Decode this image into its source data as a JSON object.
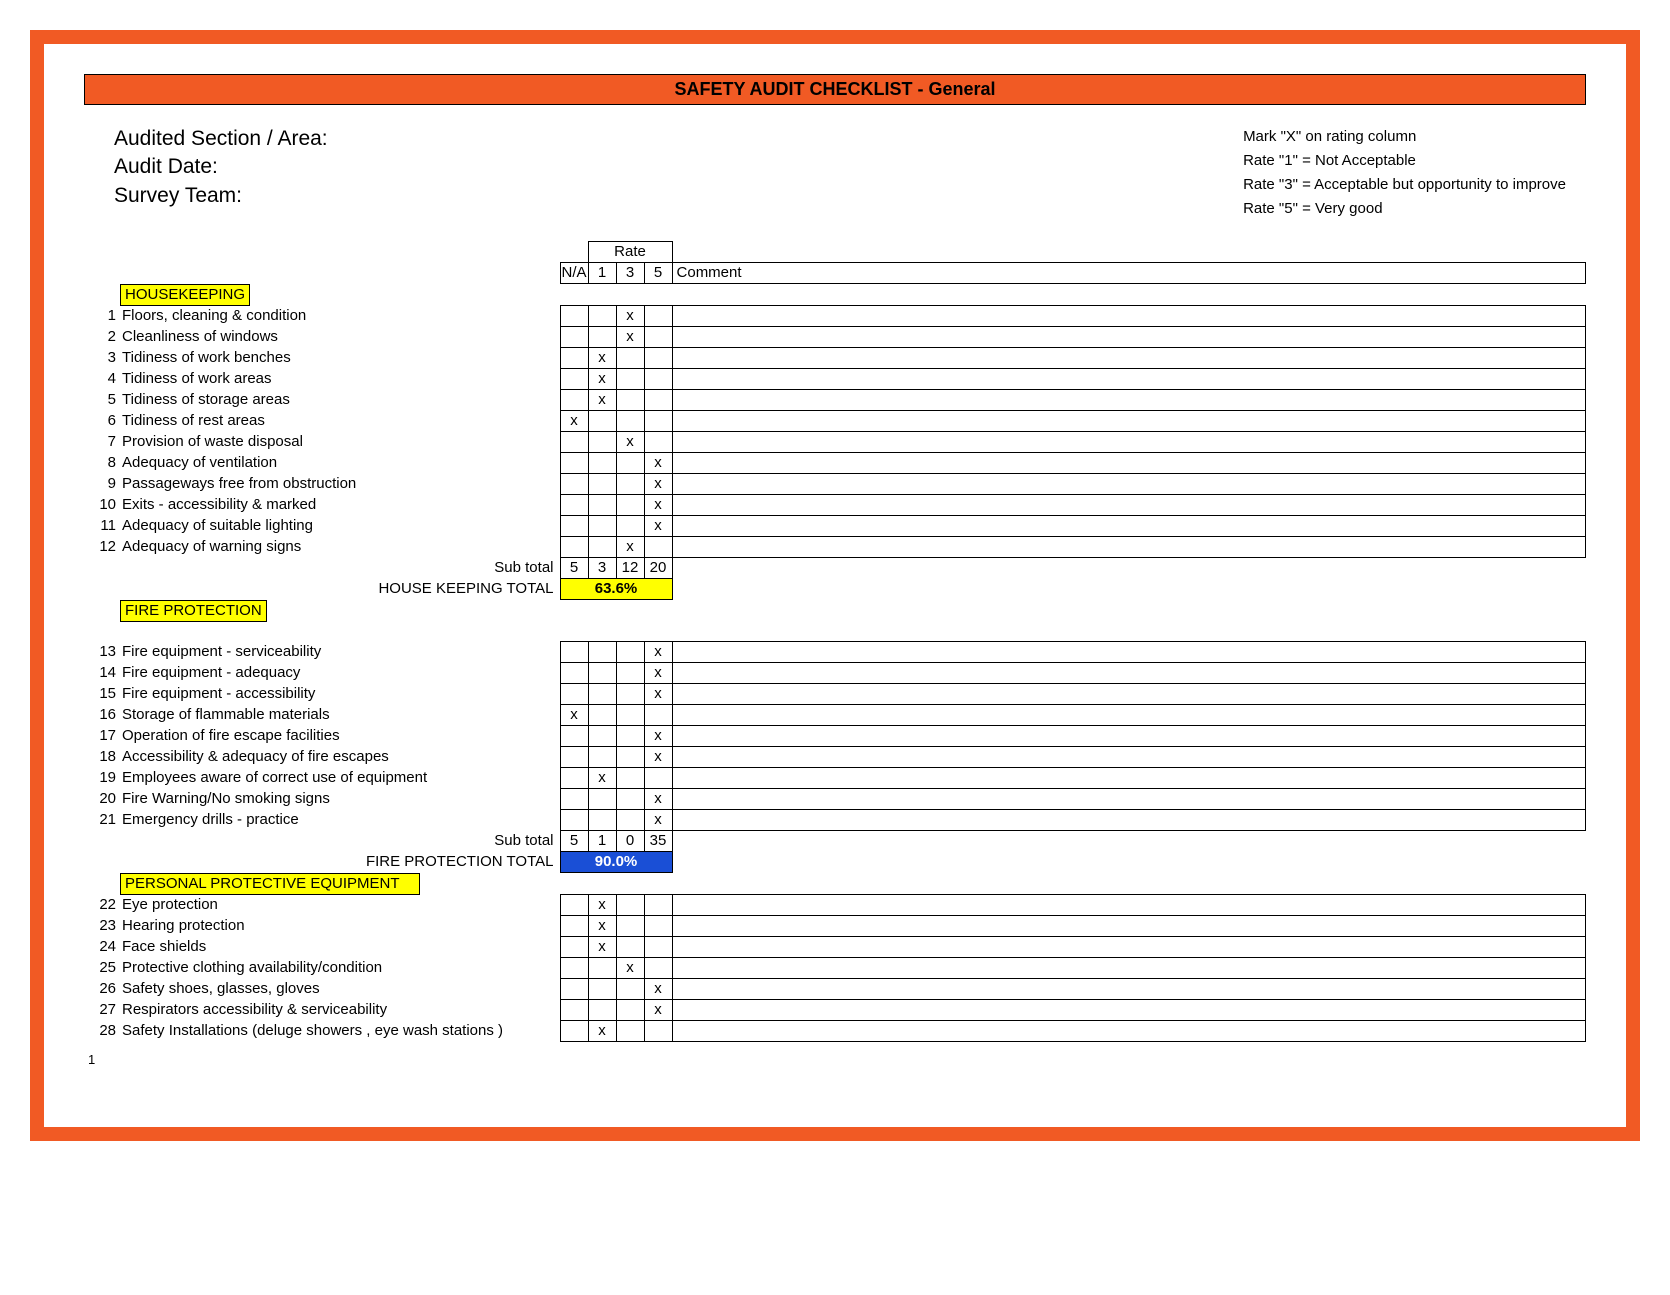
{
  "title": "SAFETY AUDIT CHECKLIST - General",
  "header": {
    "section": "Audited Section / Area:",
    "date": "Audit Date:",
    "team": "Survey Team:",
    "instr1": "Mark \"X\" on rating column",
    "instr2": "Rate \"1\" = Not Acceptable",
    "instr3": "Rate \"3\" = Acceptable but opportunity to improve",
    "instr4": "Rate \"5\" = Very good"
  },
  "cols": {
    "rate": "Rate",
    "na": "N/A",
    "c1": "1",
    "c3": "3",
    "c5": "5",
    "comment": "Comment"
  },
  "labels": {
    "subtotal": "Sub total"
  },
  "sections": {
    "hk": {
      "name": "HOUSEKEEPING",
      "items": [
        {
          "n": "1",
          "t": "Floors, cleaning & condition",
          "m": [
            " ",
            " ",
            "x",
            " "
          ]
        },
        {
          "n": "2",
          "t": "Cleanliness of windows",
          "m": [
            " ",
            " ",
            "x",
            " "
          ]
        },
        {
          "n": "3",
          "t": "Tidiness of work benches",
          "m": [
            " ",
            "x",
            " ",
            " "
          ]
        },
        {
          "n": "4",
          "t": "Tidiness of work areas",
          "m": [
            " ",
            "x",
            " ",
            " "
          ]
        },
        {
          "n": "5",
          "t": "Tidiness of storage areas",
          "m": [
            " ",
            "x",
            " ",
            " "
          ]
        },
        {
          "n": "6",
          "t": "Tidiness of rest areas",
          "m": [
            "x",
            " ",
            " ",
            " "
          ]
        },
        {
          "n": "7",
          "t": "Provision of waste disposal",
          "m": [
            " ",
            " ",
            "x",
            " "
          ]
        },
        {
          "n": "8",
          "t": "Adequacy of ventilation",
          "m": [
            " ",
            " ",
            " ",
            "x"
          ]
        },
        {
          "n": "9",
          "t": "Passageways free from obstruction",
          "m": [
            " ",
            " ",
            " ",
            "x"
          ]
        },
        {
          "n": "10",
          "t": "Exits - accessibility & marked",
          "m": [
            " ",
            " ",
            " ",
            "x"
          ]
        },
        {
          "n": "11",
          "t": "Adequacy of suitable lighting",
          "m": [
            " ",
            " ",
            " ",
            "x"
          ]
        },
        {
          "n": "12",
          "t": "Adequacy of warning signs",
          "m": [
            " ",
            " ",
            "x",
            " "
          ]
        }
      ],
      "sub": [
        "5",
        "3",
        "12",
        "20"
      ],
      "total_label": "HOUSE KEEPING TOTAL",
      "total": "63.6%"
    },
    "fp": {
      "name": "FIRE PROTECTION",
      "items": [
        {
          "n": "13",
          "t": "Fire equipment - serviceability",
          "m": [
            " ",
            " ",
            " ",
            "x"
          ]
        },
        {
          "n": "14",
          "t": "Fire equipment - adequacy",
          "m": [
            " ",
            " ",
            " ",
            "x"
          ]
        },
        {
          "n": "15",
          "t": "Fire equipment - accessibility",
          "m": [
            " ",
            " ",
            " ",
            "x"
          ]
        },
        {
          "n": "16",
          "t": "Storage of flammable materials",
          "m": [
            "x",
            " ",
            " ",
            " "
          ]
        },
        {
          "n": "17",
          "t": "Operation of fire escape facilities",
          "m": [
            " ",
            " ",
            " ",
            "x"
          ]
        },
        {
          "n": "18",
          "t": "Accessibility & adequacy of fire escapes",
          "m": [
            " ",
            " ",
            " ",
            "x"
          ]
        },
        {
          "n": "19",
          "t": "Employees aware of correct use of equipment",
          "m": [
            " ",
            "x",
            " ",
            " "
          ]
        },
        {
          "n": "20",
          "t": "Fire Warning/No smoking signs",
          "m": [
            " ",
            " ",
            " ",
            "x"
          ]
        },
        {
          "n": "21",
          "t": "Emergency drills - practice",
          "m": [
            " ",
            " ",
            " ",
            "x"
          ]
        }
      ],
      "sub": [
        "5",
        "1",
        "0",
        "35"
      ],
      "total_label": "FIRE PROTECTION TOTAL",
      "total": "90.0%"
    },
    "ppe": {
      "name": "PERSONAL PROTECTIVE EQUIPMENT",
      "items": [
        {
          "n": "22",
          "t": "Eye protection",
          "m": [
            " ",
            "x",
            " ",
            " "
          ]
        },
        {
          "n": "23",
          "t": "Hearing protection",
          "m": [
            " ",
            "x",
            " ",
            " "
          ]
        },
        {
          "n": "24",
          "t": "Face shields",
          "m": [
            " ",
            "x",
            " ",
            " "
          ]
        },
        {
          "n": "25",
          "t": "Protective clothing availability/condition",
          "m": [
            " ",
            " ",
            "x",
            " "
          ]
        },
        {
          "n": "26",
          "t": "Safety shoes, glasses, gloves",
          "m": [
            " ",
            " ",
            " ",
            "x"
          ]
        },
        {
          "n": "27",
          "t": "Respirators accessibility & serviceability",
          "m": [
            " ",
            " ",
            " ",
            "x"
          ]
        },
        {
          "n": "28",
          "t": "Safety Installations (deluge showers , eye wash stations )",
          "m": [
            " ",
            "x",
            " ",
            " "
          ]
        }
      ]
    }
  },
  "page": "1"
}
